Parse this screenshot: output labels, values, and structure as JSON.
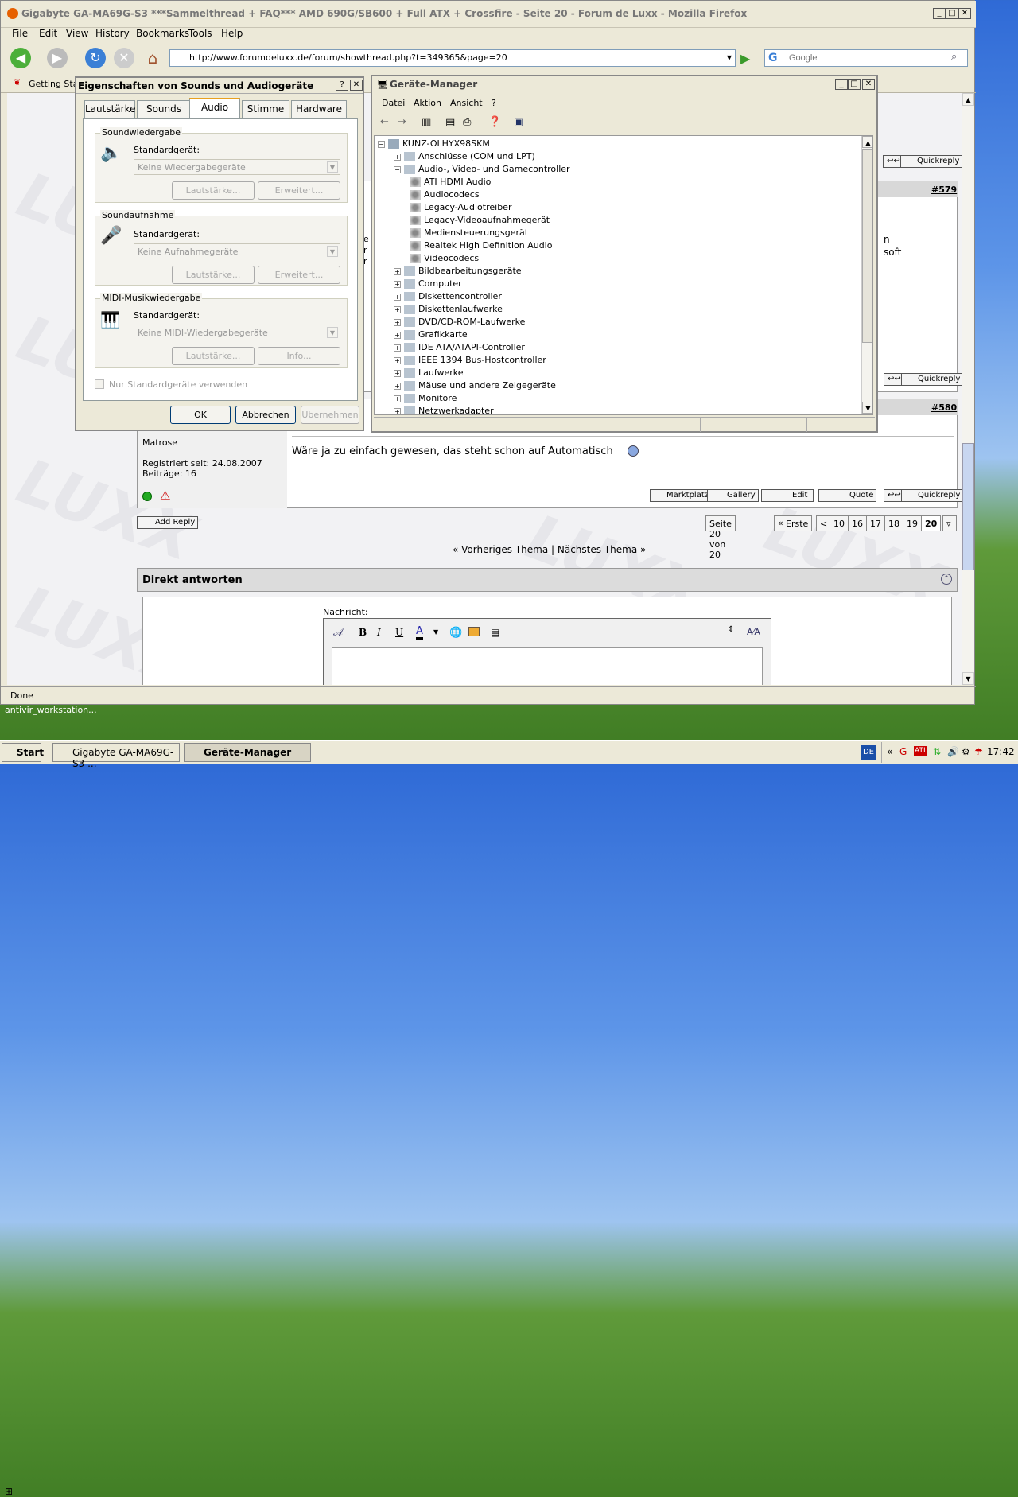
{
  "firefox": {
    "title": "Gigabyte GA-MA69G-S3 ***Sammelthread + FAQ*** AMD 690G/SB600 + Full ATX + Crossfire - Seite 20 - Forum de Luxx - Mozilla Firefox",
    "menu": [
      "File",
      "Edit",
      "View",
      "History",
      "Bookmarks",
      "Tools",
      "Help"
    ],
    "url": "http://www.forumdeluxx.de/forum/showthread.php?t=349365&page=20",
    "search_placeholder": "Google",
    "bookmark": "Getting Star",
    "status": "Done"
  },
  "forum": {
    "post_579": "#579",
    "post_580": "#580",
    "frag1": "n",
    "frag2": "soft",
    "frag3": "e",
    "frag4": "r",
    "frag5": "r",
    "user_rank": "Matrose",
    "registered": "Registriert seit: 24.08.2007",
    "posts": "Beiträge: 16",
    "message": "Wäre ja zu einfach gewesen, das steht schon auf Automatisch",
    "buttons": {
      "market": "Marktplatz",
      "gallery": "Gallery",
      "edit": "Edit",
      "quote": "Quote",
      "quickreply": "Quickreply",
      "add_reply": "Add Reply"
    },
    "pager": {
      "label": "Seite 20 von 20",
      "first": "Erste",
      "prev": "<",
      "pages": [
        "10",
        "16",
        "17",
        "18",
        "19",
        "20"
      ]
    },
    "prev_thread": "Vorheriges Thema",
    "next_thread": "Nächstes Thema",
    "direct_reply": "Direkt antworten",
    "message_label": "Nachricht:"
  },
  "sound_dialog": {
    "title": "Eigenschaften von Sounds und Audiogeräte",
    "tabs": [
      "Lautstärke",
      "Sounds",
      "Audio",
      "Stimme",
      "Hardware"
    ],
    "groups": [
      {
        "label": "Soundwiedergabe",
        "device_label": "Standardgerät:",
        "device": "Keine Wiedergabegeräte",
        "btn1": "Lautstärke...",
        "btn2": "Erweitert..."
      },
      {
        "label": "Soundaufnahme",
        "device_label": "Standardgerät:",
        "device": "Keine Aufnahmegeräte",
        "btn1": "Lautstärke...",
        "btn2": "Erweitert..."
      },
      {
        "label": "MIDI-Musikwiedergabe",
        "device_label": "Standardgerät:",
        "device": "Keine MIDI-Wiedergabegeräte",
        "btn1": "Lautstärke...",
        "btn2": "Info..."
      }
    ],
    "checkbox": "Nur Standardgeräte verwenden",
    "ok": "OK",
    "cancel": "Abbrechen",
    "apply": "Übernehmen"
  },
  "device_manager": {
    "title": "Geräte-Manager",
    "menu": [
      "Datei",
      "Aktion",
      "Ansicht",
      "?"
    ],
    "root": "KUNZ-OLHYX98SKM",
    "tree": [
      {
        "label": "Anschlüsse (COM und LPT)",
        "level": 1,
        "exp": "+"
      },
      {
        "label": "Audio-, Video- und Gamecontroller",
        "level": 1,
        "exp": "-"
      },
      {
        "label": "ATI HDMI Audio",
        "level": 2
      },
      {
        "label": "Audiocodecs",
        "level": 2
      },
      {
        "label": "Legacy-Audiotreiber",
        "level": 2
      },
      {
        "label": "Legacy-Videoaufnahmegerät",
        "level": 2
      },
      {
        "label": "Mediensteuerungsgerät",
        "level": 2
      },
      {
        "label": "Realtek High Definition Audio",
        "level": 2
      },
      {
        "label": "Videocodecs",
        "level": 2
      },
      {
        "label": "Bildbearbeitungsgeräte",
        "level": 1,
        "exp": "+"
      },
      {
        "label": "Computer",
        "level": 1,
        "exp": "+"
      },
      {
        "label": "Diskettencontroller",
        "level": 1,
        "exp": "+"
      },
      {
        "label": "Diskettenlaufwerke",
        "level": 1,
        "exp": "+"
      },
      {
        "label": "DVD/CD-ROM-Laufwerke",
        "level": 1,
        "exp": "+"
      },
      {
        "label": "Grafikkarte",
        "level": 1,
        "exp": "+"
      },
      {
        "label": "IDE ATA/ATAPI-Controller",
        "level": 1,
        "exp": "+"
      },
      {
        "label": "IEEE 1394 Bus-Hostcontroller",
        "level": 1,
        "exp": "+"
      },
      {
        "label": "Laufwerke",
        "level": 1,
        "exp": "+"
      },
      {
        "label": "Mäuse und andere Zeigegeräte",
        "level": 1,
        "exp": "+"
      },
      {
        "label": "Monitore",
        "level": 1,
        "exp": "+"
      },
      {
        "label": "Netzwerkadapter",
        "level": 1,
        "exp": "+"
      }
    ]
  },
  "desktop": {
    "tooltip": "antivir_workstation..."
  },
  "taskbar": {
    "start": "Start",
    "tasks": [
      "Gigabyte GA-MA69G-S3 ...",
      "Geräte-Manager"
    ],
    "lang": "DE",
    "time": "17:42"
  }
}
